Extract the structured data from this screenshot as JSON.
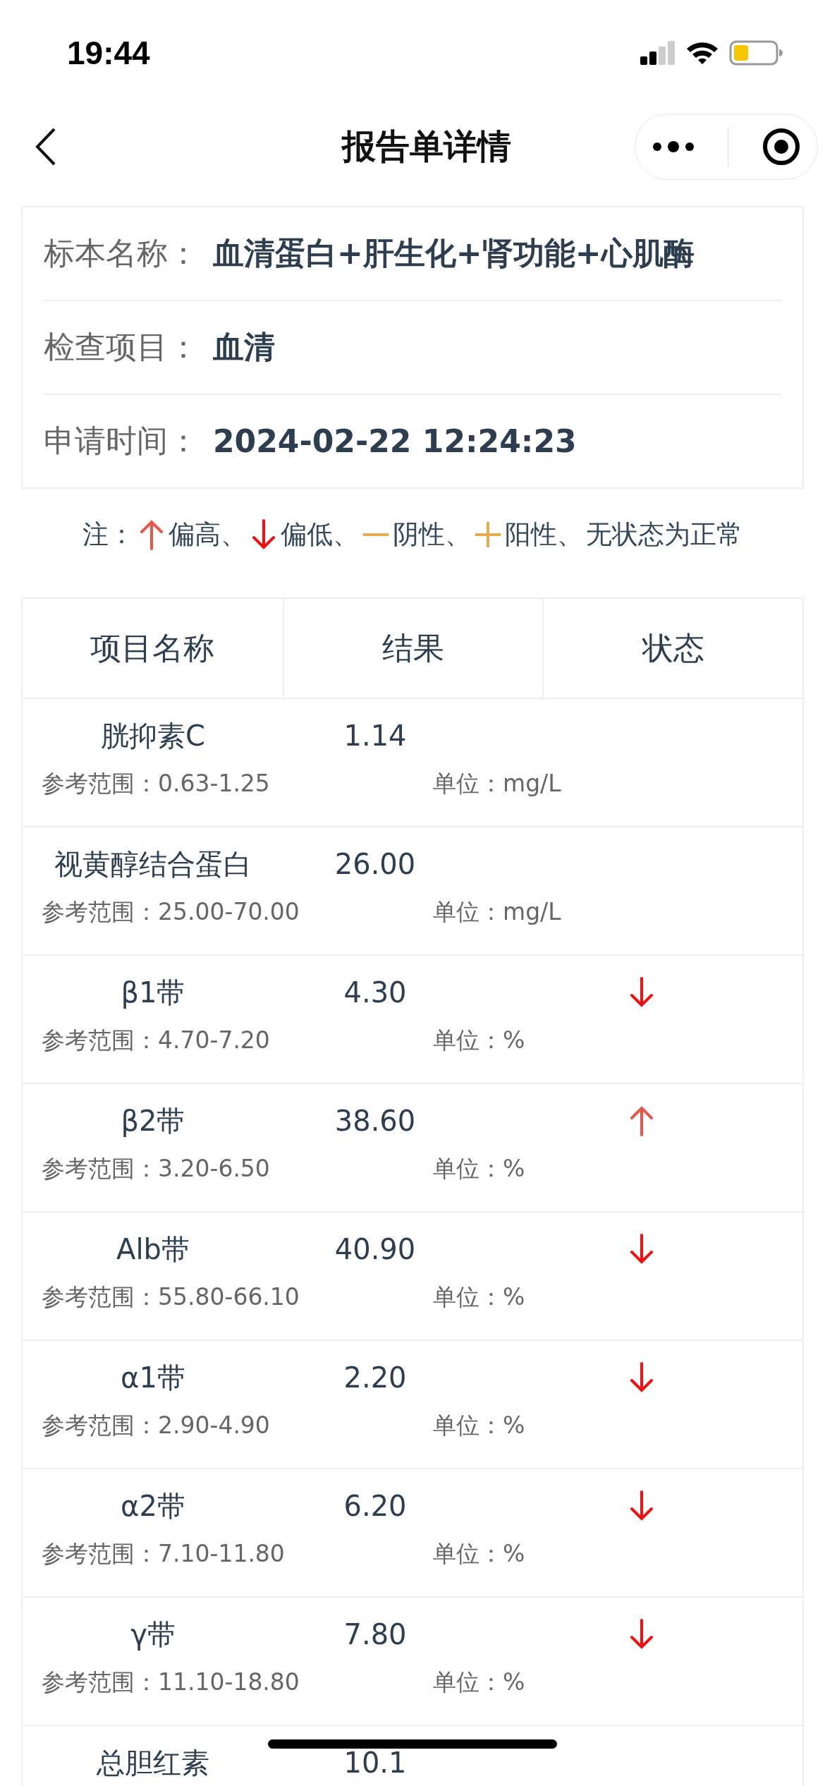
{
  "status_bar": {
    "time": "19:44"
  },
  "nav": {
    "title": "报告单详情"
  },
  "info": [
    {
      "label": "标本名称：",
      "value": "血清蛋白+肝生化+肾功能+心肌酶"
    },
    {
      "label": "检查项目：",
      "value": "血清"
    },
    {
      "label": "申请时间：",
      "value": "2024-02-22 12:24:23"
    }
  ],
  "legend": {
    "note": "注：",
    "items": [
      {
        "kind": "high",
        "label": "偏高、"
      },
      {
        "kind": "low",
        "label": "偏低、"
      },
      {
        "kind": "negative",
        "label": "阴性、"
      },
      {
        "kind": "positive",
        "label": "阳性、"
      }
    ],
    "suffix": "无状态为正常"
  },
  "table": {
    "columns": [
      "项目名称",
      "结果",
      "状态"
    ],
    "rows": [
      {
        "name": "胱抑素C",
        "value": "1.14",
        "range": "参考范围：0.63-1.25",
        "unit": "单位：mg/L",
        "high": false,
        "low": false
      },
      {
        "name": "视黄醇结合蛋白",
        "value": "26.00",
        "range": "参考范围：25.00-70.00",
        "unit": "单位：mg/L",
        "high": false,
        "low": false
      },
      {
        "name": "β1带",
        "value": "4.30",
        "range": "参考范围：4.70-7.20",
        "unit": "单位：%",
        "high": false,
        "low": true
      },
      {
        "name": "β2带",
        "value": "38.60",
        "range": "参考范围：3.20-6.50",
        "unit": "单位：%",
        "high": true,
        "low": false
      },
      {
        "name": "Alb带",
        "value": "40.90",
        "range": "参考范围：55.80-66.10",
        "unit": "单位：%",
        "high": false,
        "low": true
      },
      {
        "name": "α1带",
        "value": "2.20",
        "range": "参考范围：2.90-4.90",
        "unit": "单位：%",
        "high": false,
        "low": true
      },
      {
        "name": "α2带",
        "value": "6.20",
        "range": "参考范围：7.10-11.80",
        "unit": "单位：%",
        "high": false,
        "low": true
      },
      {
        "name": "γ带",
        "value": "7.80",
        "range": "参考范围：11.10-18.80",
        "unit": "单位：%",
        "high": false,
        "low": true
      },
      {
        "name": "总胆红素",
        "value": "10.1",
        "high": false,
        "low": false
      }
    ]
  }
}
